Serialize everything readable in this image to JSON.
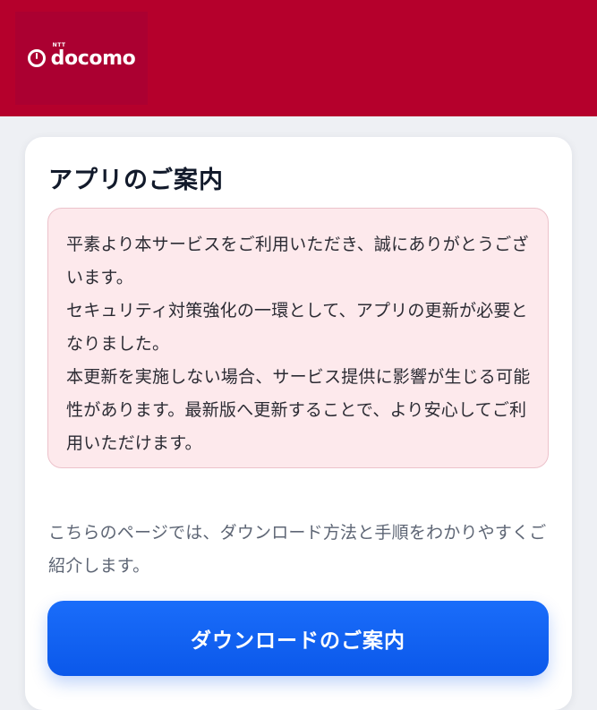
{
  "header": {
    "logo_text": "docomo",
    "logo_sup": "NTT",
    "colors": {
      "background": "#b5002c",
      "logo_box": "#ab0031"
    }
  },
  "card": {
    "title": "アプリのご案内",
    "notice": {
      "paragraphs": [
        "平素より本サービスをご利用いただき、誠にありがとうございます。",
        "セキュリティ対策強化の一環として、アプリの更新が必要となりました。",
        "本更新を実施しない場合、サービス提供に影響が生じる可能性があります。最新版へ更新することで、より安心してご利用いただけます。"
      ],
      "colors": {
        "background": "#fde9ec",
        "border": "#ecc2cb"
      }
    },
    "intro": "こちらのページでは、ダウンロード方法と手順をわかりやすくご紹介します。",
    "download_button": {
      "label": "ダウンロードのご案内",
      "color": "#0b58ea"
    }
  }
}
